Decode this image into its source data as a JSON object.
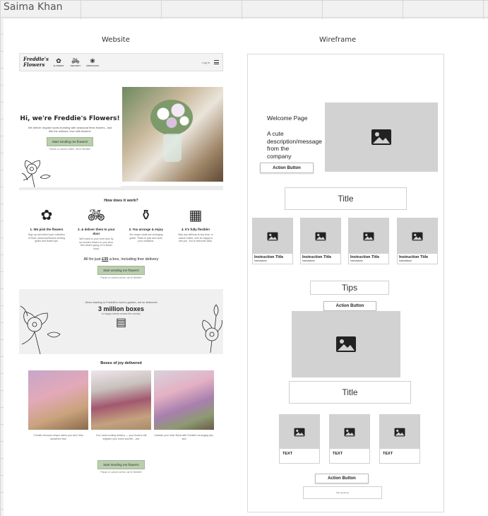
{
  "user": {
    "name": "Saima Khan"
  },
  "columns": {
    "website": "Website",
    "wireframe": "Wireframe"
  },
  "website": {
    "logo": "Freddie's Flowers",
    "nav_items": [
      {
        "icon": "flower-icon",
        "caption": "FLOWERS"
      },
      {
        "icon": "delivery-icon",
        "caption": "DELIVERY"
      },
      {
        "icon": "bouquet-icon",
        "caption": "ARRANGING"
      }
    ],
    "nav_right": "Log in",
    "hero": {
      "heading": "Hi, we're Freddie's Flowers!",
      "text": "We deliver regular boxes bursting with seasonal fresh flowers. Just like the millions, love with flowers!",
      "button": "Start sending me flowers!",
      "fine": "Pause or cancel online, we're flexible!"
    },
    "how": {
      "heading": "How does it work?",
      "steps": [
        {
          "icon": "flower-icon",
          "title": "1. We pick the flowers",
          "desc": "Sign up and select your collection of fresh, seasonal flowers arriving grabs and flower tips."
        },
        {
          "icon": "bicycle-icon",
          "title": "2. & deliver them to your door",
          "desc": "We'll send to your front door by our trusted drivers to your door. See what's going on in flower shop."
        },
        {
          "icon": "vase-icon",
          "title": "3. You arrange & enjoy",
          "desc": "Our recipe cards are arranging guide. Tricks to pick and store your creations."
        },
        {
          "icon": "calendar-icon",
          "title": "4. It's fully flexible!",
          "desc": "Skip any delivery at any time, or cancel online, we'll be happy to see you. You're welcome back."
        }
      ],
      "price_prefix": "All for just",
      "price": "£35",
      "price_suffix": "a box, including free delivery",
      "button": "Start sending me flowers!",
      "fine": "Pause or cancel online, we're flexible!"
    },
    "banner": {
      "line1": "Since starting in Freddie's mum's garden, we've delivered",
      "big": "3 million boxes",
      "line2": "to happy homes across the country"
    },
    "boxes": {
      "heading": "Boxes of joy delivered",
      "captions": [
        "Freddie chooses unique stems you won't find anywhere else",
        "Your most exciting delivery — your flowers will brighten your home and life... yes",
        "Unleash your inner florist with Freddie's arranging tips, and"
      ],
      "button": "Start sending me flowers!",
      "fine": "Pause or cancel online, we're flexible!"
    }
  },
  "wireframe": {
    "welcome": "Welcome Page",
    "description": "A cute description/message from the company",
    "action_button": "Action Button",
    "title": "Title",
    "instructions": [
      {
        "title": "Instruction Title",
        "sub": "Instructions"
      },
      {
        "title": "Instruction Title",
        "sub": "Instructions"
      },
      {
        "title": "Instruction Title",
        "sub": "Instructions"
      },
      {
        "title": "Instruction Title",
        "sub": "Instructions"
      }
    ],
    "tips": "Tips",
    "tips_button": "Action Button",
    "title2": "Title",
    "text_cards": [
      "TEXT",
      "TEXT",
      "TEXT"
    ],
    "bottom_button": "Action Button",
    "footer_text": "Sub sentence"
  }
}
